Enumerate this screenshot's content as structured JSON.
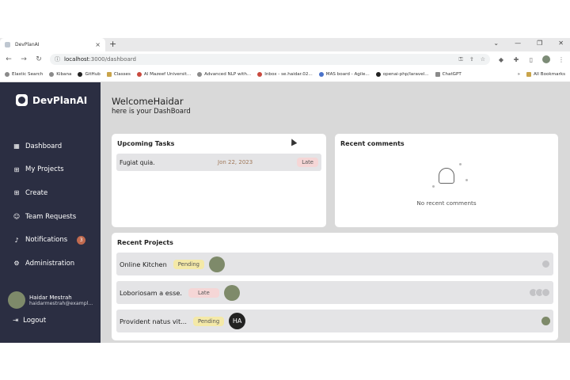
{
  "browser": {
    "tab_title": "DevPlanAI",
    "url_host": "localhost",
    "url_path": ":3000/dashboard",
    "bookmarks": [
      "Elastic Search",
      "Kibana",
      "GitHub",
      "Classes",
      "Al Mazeef Universit...",
      "Advanced NLP with...",
      "Inbox - se.haidar.02...",
      "MAS board - Agile...",
      "openai-php/laravel...",
      "ChatGPT"
    ],
    "more_bookmarks": "»",
    "all_bookmarks": "All Bookmarks"
  },
  "sidebar": {
    "brand": "DevPlanAI",
    "items": [
      {
        "label": "Dashboard",
        "icon": "dashboard-icon"
      },
      {
        "label": "My Projects",
        "icon": "projects-icon"
      },
      {
        "label": "Create",
        "icon": "plus-square-icon"
      },
      {
        "label": "Team Requests",
        "icon": "user-add-icon"
      },
      {
        "label": "Notifications",
        "icon": "bell-icon",
        "badge": "3"
      },
      {
        "label": "Administration",
        "icon": "admin-icon"
      }
    ],
    "user_name": "Haidar Mestrah",
    "user_email": "haidarmestrah@exampl...",
    "logout": "Logout"
  },
  "main": {
    "welcome": "WelcomeHaidar",
    "subtitle": "here is your DashBoard",
    "upcoming_title": "Upcoming Tasks",
    "tasks": [
      {
        "name": "Fugiat quia.",
        "date": "Jon 22, 2023",
        "status": "Late"
      }
    ],
    "comments_title": "Recent comments",
    "no_comments": "No recent comments",
    "projects_title": "Recent Projects",
    "projects": [
      {
        "name": "Online Kitchen",
        "status": "Pending",
        "owner_initials": ""
      },
      {
        "name": "Loboriosam a esse.",
        "status": "Late",
        "owner_initials": ""
      },
      {
        "name": "Provident natus vit...",
        "status": "Pending",
        "owner_initials": "HA"
      }
    ]
  }
}
